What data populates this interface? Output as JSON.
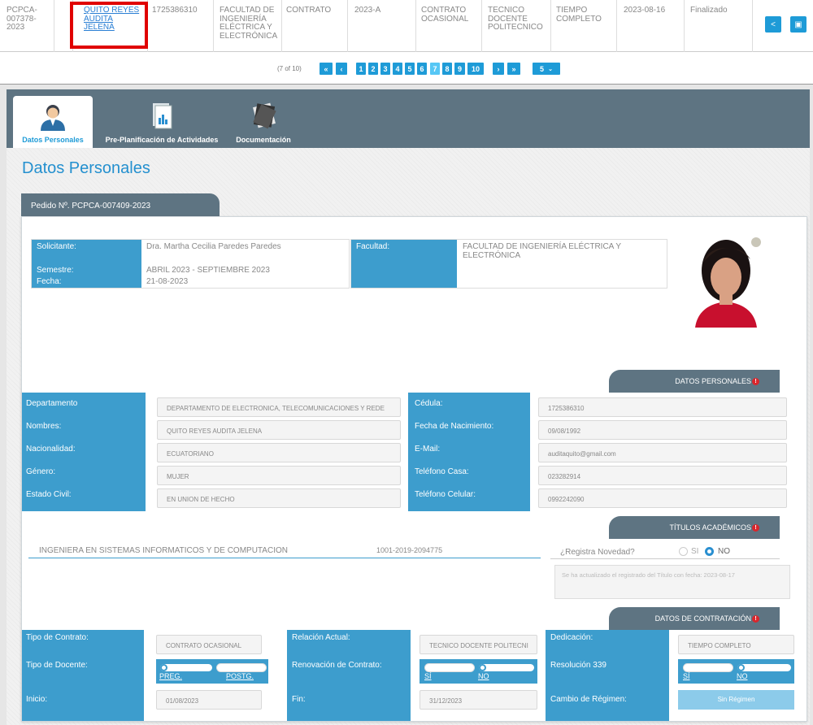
{
  "table_row": {
    "code": "PCPCA-007378-2023",
    "name": "QUITO REYES AUDITA JELENA",
    "cedula": "1725386310",
    "facultad": "FACULTAD DE INGENIERÍA ELÉCTRICA Y ELECTRÓNICA",
    "tipo": "CONTRATO",
    "periodo": "2023-A",
    "relacion": "CONTRATO OCASIONAL",
    "cargo": "TECNICO DOCENTE POLITECNICO",
    "dedicacion": "TIEMPO COMPLETO",
    "fecha": "2023-08-16",
    "estado": "Finalizado",
    "share_icon": "share-icon",
    "pdf_icon": "pdf-icon"
  },
  "pager": {
    "status": "(7 of 10)",
    "first": "«",
    "prev": "‹",
    "pages": [
      "1",
      "2",
      "3",
      "4",
      "5",
      "6",
      "7",
      "8",
      "9",
      "10"
    ],
    "next": "›",
    "last": "»",
    "rows": "5",
    "current": 7
  },
  "tabs": [
    {
      "label": "Datos Personales",
      "icon": "user-icon"
    },
    {
      "label": "Pre-Planificación de Actividades",
      "icon": "report-icon"
    },
    {
      "label": "Documentación",
      "icon": "documents-icon"
    }
  ],
  "page_title": "Datos Personales",
  "pedido": "Pedido Nº. PCPCA-007409-2023",
  "solicitud": {
    "solicitante_label": "Solicitante:",
    "solicitante": "Dra. Martha Cecilia Paredes Paredes",
    "semestre_label": "Semestre:",
    "semestre": "ABRIL 2023 - SEPTIEMBRE 2023",
    "fecha_label": "Fecha:",
    "fecha": "21-08-2023",
    "facultad_label": "Facultad:",
    "facultad": "FACULTAD DE INGENIERÍA ELÉCTRICA Y ELECTRÓNICA"
  },
  "datos_personales": {
    "header": "DATOS PERSONALES",
    "left": [
      {
        "label": "Departamento",
        "value": "DEPARTAMENTO DE ELECTRONICA, TELECOMUNICACIONES Y REDE"
      },
      {
        "label": "Nombres:",
        "value": "QUITO REYES AUDITA JELENA"
      },
      {
        "label": "Nacionalidad:",
        "value": "ECUATORIANO"
      },
      {
        "label": "Género:",
        "value": "MUJER"
      },
      {
        "label": "Estado Civil:",
        "value": "EN UNION DE HECHO"
      }
    ],
    "right": [
      {
        "label": "Cédula:",
        "value": "1725386310"
      },
      {
        "label": "Fecha de Nacimiento:",
        "value": "09/08/1992"
      },
      {
        "label": "E-Mail:",
        "value": "auditaquito@gmail.com"
      },
      {
        "label": "Teléfono Casa:",
        "value": "023282914"
      },
      {
        "label": "Teléfono Celular:",
        "value": "0992242090"
      }
    ]
  },
  "titulos": {
    "header": "TÍTULOS ACADÉMICOS",
    "titulo": "INGENIERA EN SISTEMAS INFORMATICOS Y DE COMPUTACION",
    "registro": "1001-2019-2094775",
    "novedad_label": "¿Registra Novedad?",
    "si": "SI",
    "no": "NO",
    "novedad_text": "Se ha actualizado el registrado del Título con fecha: 2023-08-17"
  },
  "contratacion": {
    "header": "DATOS DE CONTRATACIÓN",
    "tipo_contrato_label": "Tipo de Contrato:",
    "tipo_contrato": "CONTRATO OCASIONAL",
    "tipo_docente_label": "Tipo de Docente:",
    "preg": "PREG.",
    "postg": "POSTG.",
    "inicio_label": "Inicio:",
    "inicio": "01/08/2023",
    "relacion_label": "Relación Actual:",
    "relacion": "TECNICO DOCENTE POLITECNI",
    "renovacion_label": "Renovación de Contrato:",
    "si": "SÍ",
    "no": "NO",
    "fin_label": "Fin:",
    "fin": "31/12/2023",
    "dedicacion_label": "Dedicación:",
    "dedicacion": "TIEMPO COMPLETO",
    "resolucion_label": "Resolución 339",
    "cambio_label": "Cambio de Régimen:",
    "sin_regimen": "Sin Régimen"
  },
  "colors": {
    "accent": "#1e9bd7",
    "label_bg": "#3d9dcd",
    "header_bg": "#5e7482",
    "alert": "#d9262c",
    "highlight": "#e00000"
  }
}
